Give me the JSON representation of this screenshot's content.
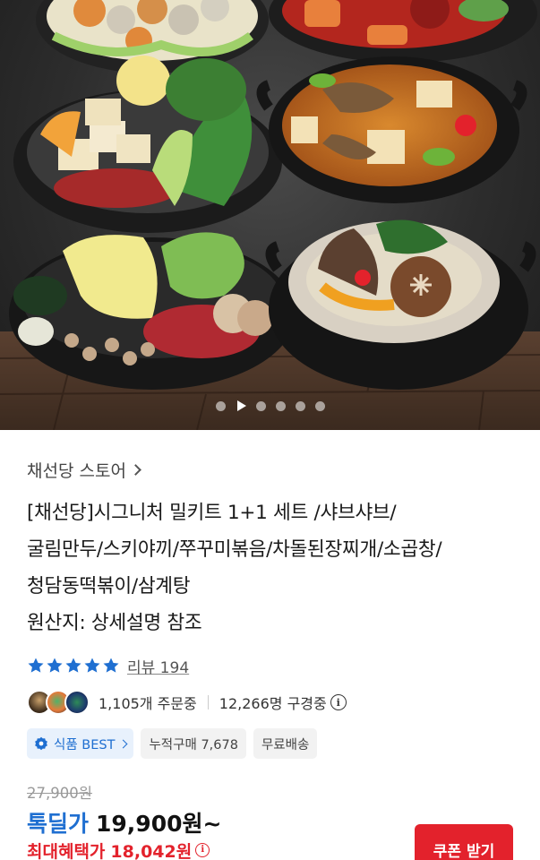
{
  "carousel": {
    "pages": 6,
    "active_index": 1
  },
  "store": {
    "name": "채선당 스토어"
  },
  "product": {
    "title_lines": [
      "[채선당]시그니처 밀키트 1+1 세트 /샤브샤브/",
      "굴림만두/스키야끼/쭈꾸미볶음/차돌된장찌개/소곱창/",
      "청담동떡볶이/삼계탕",
      "원산지: 상세설명 참조"
    ]
  },
  "rating": {
    "stars": 5,
    "review_label": "리뷰 194"
  },
  "social": {
    "orders": "1,105개 주문중",
    "viewers": "12,266명 구경중"
  },
  "tags": {
    "best": "식품 BEST",
    "cumulative": "누적구매 7,678",
    "shipping": "무료배송"
  },
  "price": {
    "original": "27,900원",
    "sale_label": "톡딜가",
    "sale_price": "19,900원~",
    "max_label": "최대혜택가",
    "max_price": "18,042원"
  },
  "coupon_button": "쿠폰 받기",
  "colors": {
    "accent_blue": "#1f6fd1",
    "accent_red": "#e3222c",
    "star": "#1f6fd1"
  }
}
